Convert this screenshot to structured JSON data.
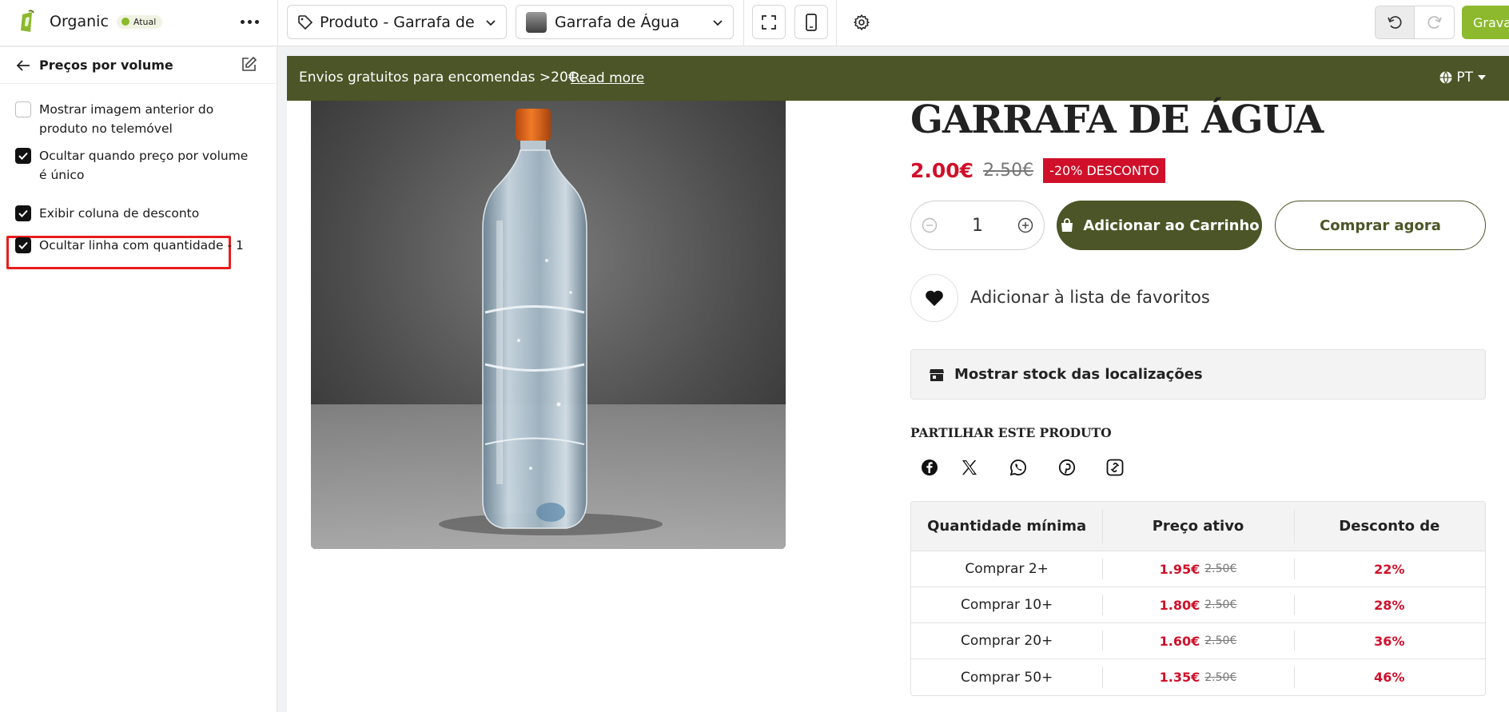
{
  "app": {
    "name": "Organic",
    "badge": "Atual",
    "template_select": "Produto - Garrafa de Á...",
    "product_select": "Garrafa de Água",
    "save_label": "Grava",
    "accent_color": "#8cb92d"
  },
  "sidebar": {
    "title": "Preços por volume",
    "options": [
      {
        "label": "Mostrar imagem anterior do produto no telemóvel",
        "checked": false
      },
      {
        "label": "Ocultar quando preço por volume é único",
        "checked": true
      },
      {
        "label": "Exibir coluna de desconto",
        "checked": true
      },
      {
        "label": "Ocultar linha com quantidade - 1",
        "checked": true
      }
    ]
  },
  "announcement": {
    "text": "Envios gratuitos para encomendas >20€",
    "link": "Read more",
    "language": "PT",
    "bg_color": "#4b5527"
  },
  "product": {
    "title": "GARRAFA DE ÁGUA",
    "price": "2.00€",
    "compare_price": "2.50€",
    "discount_badge": "-20% DESCONTO",
    "quantity": "1",
    "add_to_cart": "Adicionar ao Carrinho",
    "buy_now": "Comprar agora",
    "wishlist": "Adicionar à lista de favoritos",
    "stock": "Mostrar stock das localizações",
    "share_title": "PARTILHAR ESTE PRODUTO",
    "share_icons": [
      "facebook-icon",
      "x-icon",
      "whatsapp-icon",
      "pinterest-icon",
      "link-icon"
    ]
  },
  "volume_table": {
    "headers": [
      "Quantidade mínima",
      "Preço ativo",
      "Desconto de"
    ],
    "rows": [
      {
        "qty": "Comprar 2+",
        "price": "1.95€",
        "old": "2.50€",
        "discount": "22%"
      },
      {
        "qty": "Comprar 10+",
        "price": "1.80€",
        "old": "2.50€",
        "discount": "28%"
      },
      {
        "qty": "Comprar 20+",
        "price": "1.60€",
        "old": "2.50€",
        "discount": "36%"
      },
      {
        "qty": "Comprar 50+",
        "price": "1.35€",
        "old": "2.50€",
        "discount": "46%"
      }
    ]
  }
}
